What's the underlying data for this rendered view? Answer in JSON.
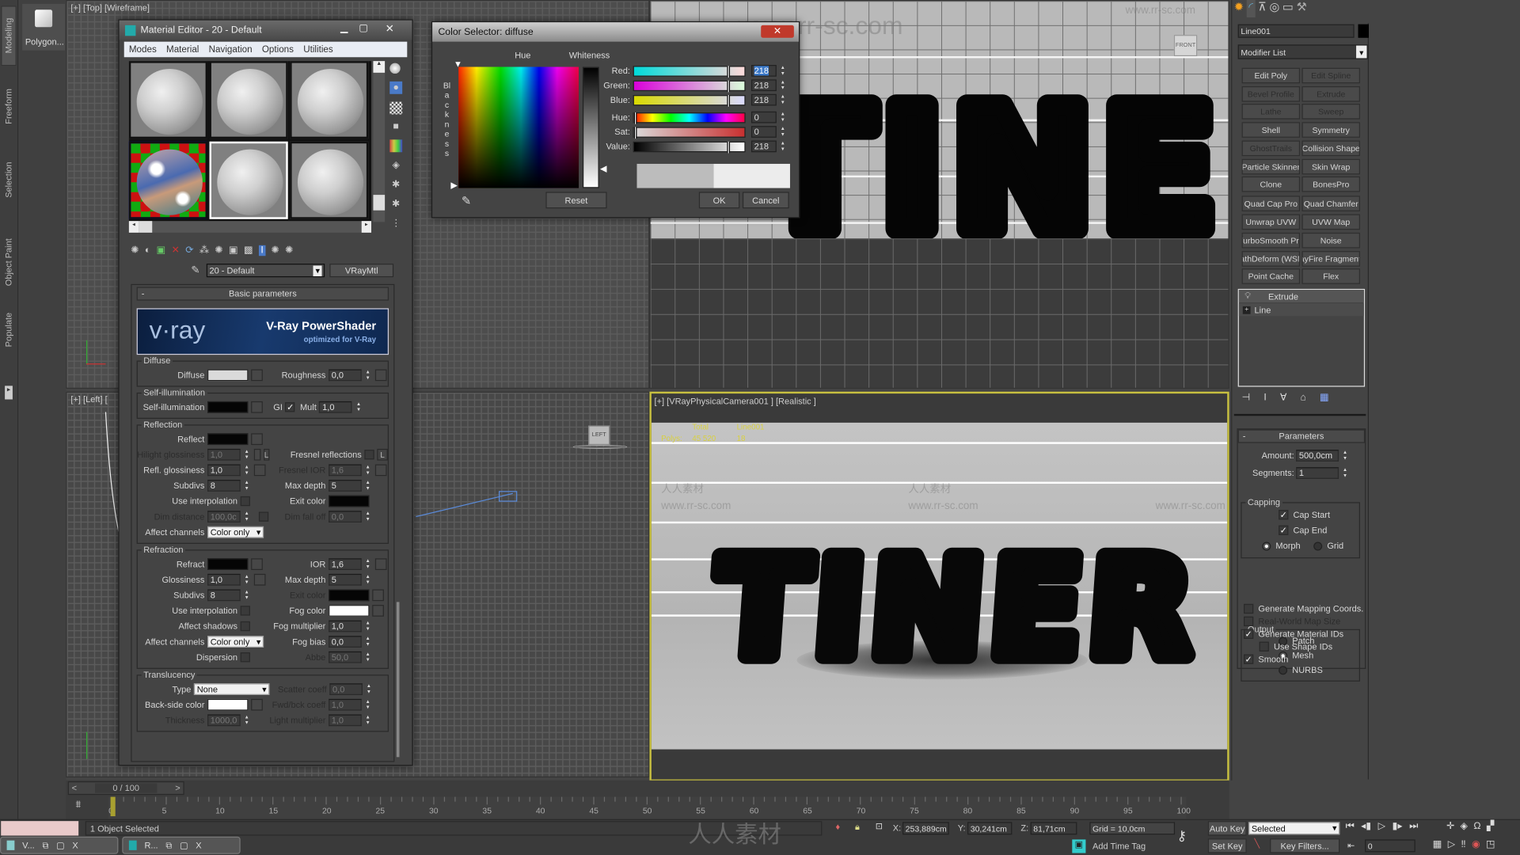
{
  "colors": {
    "active_viewport": "#c8c040",
    "close_button": "#c0392b",
    "selection": "#3a78c8",
    "diffuse_swatch": "#dadada",
    "stats_text": "#d8d040"
  },
  "ribbon": {
    "tabs": [
      "Modeling",
      "Freeform",
      "Selection",
      "Object Paint",
      "Populate"
    ],
    "active_tab": "Modeling",
    "tool_label": "Polygon..."
  },
  "watermark": {
    "url": "www.rr-sc.com",
    "cn": "人人素材"
  },
  "viewports": {
    "top": {
      "label": "[+] [Top] [Wireframe]"
    },
    "left": {
      "label": "[+] [Left] [",
      "viewcube": "LEFT"
    },
    "front": {
      "viewcube": "FRONT",
      "lettering": "TINER"
    },
    "perspective": {
      "label": "[+] [VRayPhysicalCamera001 ] [Realistic ]",
      "stats": {
        "col_total": "Total",
        "col_object": "Line001",
        "row_label": "Polys:",
        "total": "45 520",
        "object": "18"
      },
      "lettering": "TINER"
    }
  },
  "material_editor": {
    "title": "Material Editor - 20 - Default",
    "menu": [
      "Modes",
      "Material",
      "Navigation",
      "Options",
      "Utilities"
    ],
    "active_slot": 4,
    "material_name": "20 - Default",
    "material_type": "VRayMtl",
    "rollout_title": "Basic parameters",
    "banner": {
      "logo": "v·ray",
      "title": "V-Ray PowerShader",
      "subtitle": "optimized for V-Ray"
    },
    "groups": [
      {
        "title": "Diffuse",
        "rows": [
          [
            [
              {
                "label": "Diffuse",
                "kind": "color",
                "color": "#dadada",
                "map": true
              }
            ],
            [
              {
                "label": "Roughness",
                "kind": "spinner",
                "value": "0,0",
                "map": true
              }
            ]
          ]
        ]
      },
      {
        "title": "Self-illumination",
        "rows": [
          [
            [
              {
                "label": "Self-illumination",
                "kind": "color",
                "color": "#050505",
                "map": true
              }
            ],
            [
              {
                "label": "GI",
                "kind": "checkbox",
                "checked": true,
                "inline": true
              },
              {
                "label": "Mult",
                "kind": "spinner",
                "value": "1,0",
                "inline": true
              }
            ]
          ]
        ]
      },
      {
        "title": "Reflection",
        "rows": [
          [
            [
              {
                "label": "Reflect",
                "kind": "color",
                "color": "#050505",
                "map": true
              }
            ],
            []
          ],
          [
            [
              {
                "label": "Hilight glossiness",
                "kind": "spinner",
                "value": "1,0",
                "disabled": true,
                "map": true
              },
              {
                "kind": "lbutton",
                "label": "L"
              }
            ],
            [
              {
                "label": "Fresnel reflections",
                "kind": "checkbox",
                "checked": false
              },
              {
                "kind": "lbutton",
                "label": "L"
              }
            ]
          ],
          [
            [
              {
                "label": "Refl. glossiness",
                "kind": "spinner",
                "value": "1,0",
                "map": true
              }
            ],
            [
              {
                "label": "Fresnel IOR",
                "kind": "spinner",
                "value": "1,6",
                "disabled": true,
                "map": true
              }
            ]
          ],
          [
            [
              {
                "label": "Subdivs",
                "kind": "spinner",
                "value": "8"
              }
            ],
            [
              {
                "label": "Max depth",
                "kind": "spinner",
                "value": "5"
              }
            ]
          ],
          [
            [
              {
                "label": "Use interpolation",
                "kind": "checkbox",
                "checked": false
              }
            ],
            [
              {
                "label": "Exit color",
                "kind": "color",
                "color": "#050505"
              }
            ]
          ],
          [
            [
              {
                "label": "Dim distance",
                "kind": "spinner",
                "value": "100,0c",
                "disabled": true
              },
              {
                "kind": "checkbox",
                "checked": false,
                "inline": true,
                "label": ""
              }
            ],
            [
              {
                "label": "Dim fall off",
                "kind": "spinner",
                "value": "0,0",
                "disabled": true
              }
            ]
          ],
          [
            [
              {
                "label": "Affect channels",
                "kind": "dropdown",
                "value": "Color only"
              }
            ],
            []
          ]
        ]
      },
      {
        "title": "Refraction",
        "rows": [
          [
            [
              {
                "label": "Refract",
                "kind": "color",
                "color": "#050505",
                "map": true
              }
            ],
            [
              {
                "label": "IOR",
                "kind": "spinner",
                "value": "1,6",
                "map": true
              }
            ]
          ],
          [
            [
              {
                "label": "Glossiness",
                "kind": "spinner",
                "value": "1,0",
                "map": true
              }
            ],
            [
              {
                "label": "Max depth",
                "kind": "spinner",
                "value": "5"
              }
            ]
          ],
          [
            [
              {
                "label": "Subdivs",
                "kind": "spinner",
                "value": "8"
              }
            ],
            [
              {
                "label": "Exit color",
                "kind": "color",
                "color": "#050505",
                "disabled": true,
                "map": true
              }
            ]
          ],
          [
            [
              {
                "label": "Use interpolation",
                "kind": "checkbox",
                "checked": false
              }
            ],
            [
              {
                "label": "Fog color",
                "kind": "color",
                "color": "#ffffff",
                "map": true
              }
            ]
          ],
          [
            [
              {
                "label": "Affect shadows",
                "kind": "checkbox",
                "checked": false
              }
            ],
            [
              {
                "label": "Fog multiplier",
                "kind": "spinner",
                "value": "1,0"
              }
            ]
          ],
          [
            [
              {
                "label": "Affect channels",
                "kind": "dropdown",
                "value": "Color only"
              }
            ],
            [
              {
                "label": "Fog bias",
                "kind": "spinner",
                "value": "0,0"
              }
            ]
          ],
          [
            [
              {
                "label": "Dispersion",
                "kind": "checkbox",
                "checked": false
              }
            ],
            [
              {
                "label": "Abbe",
                "kind": "spinner",
                "value": "50,0",
                "disabled": true
              }
            ]
          ]
        ]
      },
      {
        "title": "Translucency",
        "rows": [
          [
            [
              {
                "label": "Type",
                "kind": "dropdown",
                "value": "None",
                "wide": true
              }
            ],
            [
              {
                "label": "Scatter coeff",
                "kind": "spinner",
                "value": "0,0",
                "disabled": true
              }
            ]
          ],
          [
            [
              {
                "label": "Back-side color",
                "kind": "color",
                "color": "#ffffff",
                "map": true
              }
            ],
            [
              {
                "label": "Fwd/bck coeff",
                "kind": "spinner",
                "value": "1,0",
                "disabled": true
              }
            ]
          ],
          [
            [
              {
                "label": "Thickness",
                "kind": "spinner",
                "value": "1000,0",
                "disabled": true
              }
            ],
            [
              {
                "label": "Light multiplier",
                "kind": "spinner",
                "value": "1,0",
                "disabled": true
              }
            ]
          ]
        ]
      }
    ]
  },
  "color_selector": {
    "title": "Color Selector: diffuse",
    "hue_label": "Hue",
    "whiteness_label": "Whiteness",
    "blackness_label": "Blackness",
    "channels": [
      {
        "label": "Red:",
        "value": 218,
        "max": 255,
        "gradient": "linear-gradient(90deg,#00dada,#ffdada)",
        "selected": true
      },
      {
        "label": "Green:",
        "value": 218,
        "max": 255,
        "gradient": "linear-gradient(90deg,#da00da,#daffda)"
      },
      {
        "label": "Blue:",
        "value": 218,
        "max": 255,
        "gradient": "linear-gradient(90deg,#dada00,#dadaff)"
      },
      {
        "label": "Hue:",
        "value": 0,
        "max": 255,
        "gradient": "linear-gradient(90deg,#f00,#ff0,#0f0,#0ff,#00f,#f0f,#f04)"
      },
      {
        "label": "Sat:",
        "value": 0,
        "max": 255,
        "gradient": "linear-gradient(90deg,#dadada,#c83030)"
      },
      {
        "label": "Value:",
        "value": 218,
        "max": 255,
        "gradient": "linear-gradient(90deg,#000,#fff)"
      }
    ],
    "preview_old": "#bcbcbc",
    "preview_new": "#ececec",
    "reset_label": "Reset",
    "ok_label": "OK",
    "cancel_label": "Cancel"
  },
  "command_panel": {
    "object_name": "Line001",
    "object_color": "#000000",
    "modifier_list": "Modifier List",
    "modifier_buttons": [
      {
        "label": "Edit Poly"
      },
      {
        "label": "Edit Spline",
        "disabled": true
      },
      {
        "label": "Bevel Profile",
        "disabled": true
      },
      {
        "label": "Extrude",
        "disabled": true
      },
      {
        "label": "Lathe",
        "disabled": true
      },
      {
        "label": "Sweep",
        "disabled": true
      },
      {
        "label": "Shell"
      },
      {
        "label": "Symmetry"
      },
      {
        "label": "GhostTrails",
        "disabled": true
      },
      {
        "label": "Collision Shape"
      },
      {
        "label": "Particle Skinner"
      },
      {
        "label": "Skin Wrap"
      },
      {
        "label": "Clone"
      },
      {
        "label": "BonesPro"
      },
      {
        "label": "Quad Cap Pro"
      },
      {
        "label": "Quad Chamfer"
      },
      {
        "label": "Unwrap UVW"
      },
      {
        "label": "UVW Map"
      },
      {
        "label": "TurboSmooth Pro"
      },
      {
        "label": "Noise"
      },
      {
        "label": "PathDeform (WSM)"
      },
      {
        "label": "RayFire Fragmenter"
      },
      {
        "label": "Point Cache"
      },
      {
        "label": "Flex"
      }
    ],
    "stack": [
      {
        "label": "Extrude",
        "selected": true
      },
      {
        "label": "Line",
        "expandable": true
      }
    ],
    "parameters": {
      "title": "Parameters",
      "amount_label": "Amount:",
      "amount": "500,0cm",
      "segments_label": "Segments:",
      "segments": "1",
      "capping_title": "Capping",
      "cap_start": {
        "label": "Cap Start",
        "checked": true
      },
      "cap_end": {
        "label": "Cap End",
        "checked": true
      },
      "morph": {
        "label": "Morph",
        "selected": true
      },
      "grid": {
        "label": "Grid",
        "selected": false
      },
      "output_title": "Output",
      "patch": {
        "label": "Patch",
        "selected": false
      },
      "mesh": {
        "label": "Mesh",
        "selected": true
      },
      "nurbs": {
        "label": "NURBS",
        "selected": false
      },
      "gen_mapping": {
        "label": "Generate Mapping Coords.",
        "checked": false
      },
      "real_world": {
        "label": "Real-World Map Size",
        "checked": false,
        "disabled": true
      },
      "gen_mat_ids": {
        "label": "Generate Material IDs",
        "checked": true
      },
      "use_shape_ids": {
        "label": "Use Shape IDs",
        "checked": false
      },
      "smooth": {
        "label": "Smooth",
        "checked": true
      }
    }
  },
  "timeline": {
    "frame_display": "0 / 100",
    "current_frame": 0,
    "range": [
      0,
      100
    ],
    "tick_labels": [
      0,
      5,
      10,
      15,
      20,
      25,
      30,
      35,
      40,
      45,
      50,
      55,
      60,
      65,
      70,
      75,
      80,
      85,
      90,
      95,
      100
    ]
  },
  "status": {
    "selection": "1 Object Selected",
    "x_label": "X:",
    "x": "253,889cm",
    "y_label": "Y:",
    "y": "30,241cm",
    "z_label": "Z:",
    "z": "81,71cm",
    "grid": "Grid = 10,0cm",
    "add_time_tag": "Add Time Tag",
    "auto_key": "Auto Key",
    "set_key": "Set Key",
    "key_mode": "Selected",
    "key_filters": "Key Filters...",
    "frame": "0",
    "taskbar": [
      "V...",
      "R..."
    ]
  }
}
